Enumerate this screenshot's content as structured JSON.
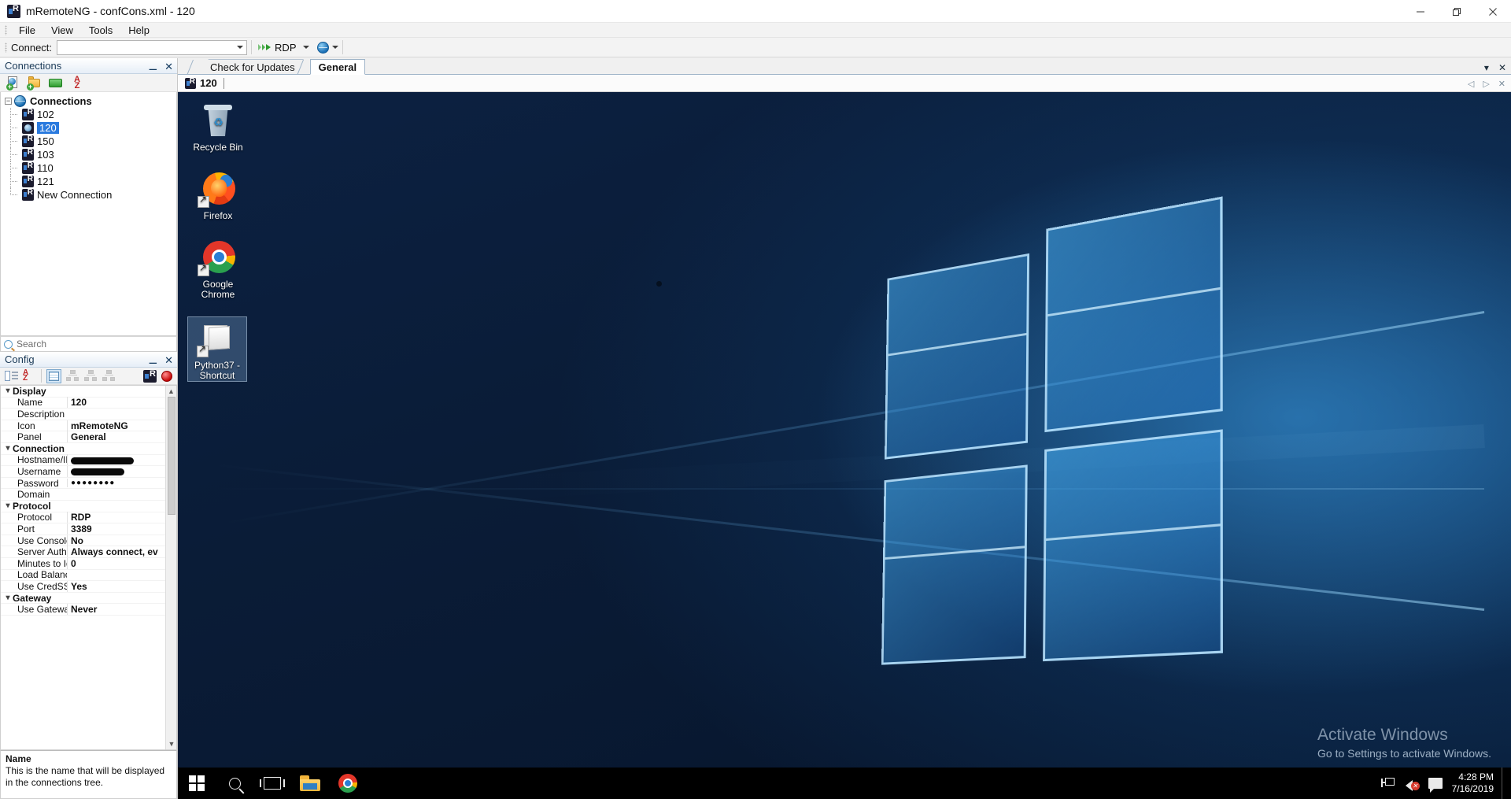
{
  "window": {
    "title": "mRemoteNG - confCons.xml - 120",
    "app_icon": "mremoteng-icon",
    "minimize": "—",
    "maximize": "❐",
    "close": "✕"
  },
  "menubar": {
    "items": [
      {
        "label": "File"
      },
      {
        "label": "View"
      },
      {
        "label": "Tools"
      },
      {
        "label": "Help"
      }
    ]
  },
  "toolbar": {
    "connect_label": "Connect:",
    "connect_value": "",
    "connect_placeholder": "",
    "protocol": "RDP"
  },
  "connections_panel": {
    "title": "Connections",
    "pin": "⚊",
    "close": "✕",
    "toolbar": [
      {
        "name": "new-connection-icon"
      },
      {
        "name": "new-folder-icon"
      },
      {
        "name": "new-session-icon"
      },
      {
        "name": "sort-az-icon",
        "label": "A",
        "sub": "Z"
      }
    ],
    "tree": {
      "root": "Connections",
      "nodes": [
        {
          "label": "102",
          "state": "idle"
        },
        {
          "label": "120",
          "state": "connected",
          "selected": true
        },
        {
          "label": "150",
          "state": "idle"
        },
        {
          "label": "103",
          "state": "idle"
        },
        {
          "label": "110",
          "state": "idle"
        },
        {
          "label": "121",
          "state": "idle"
        },
        {
          "label": "New Connection",
          "state": "idle"
        }
      ]
    },
    "search_placeholder": "Search"
  },
  "config_panel": {
    "title": "Config",
    "pin": "⚊",
    "close": "✕",
    "toolbar": [
      {
        "name": "categorized-icon"
      },
      {
        "name": "sort-alphabetical-icon"
      },
      {
        "name": "properties-icon"
      },
      {
        "name": "inheritance-icon"
      },
      {
        "name": "default-properties-icon"
      },
      {
        "name": "default-inheritance-icon"
      },
      {
        "name": "mremoteng-icon"
      },
      {
        "name": "record-icon"
      }
    ],
    "groups": [
      {
        "name": "Display",
        "rows": [
          {
            "name": "Name",
            "value": "120"
          },
          {
            "name": "Description",
            "value": ""
          },
          {
            "name": "Icon",
            "value": "mRemoteNG"
          },
          {
            "name": "Panel",
            "value": "General"
          }
        ]
      },
      {
        "name": "Connection",
        "rows": [
          {
            "name": "Hostname/IP",
            "value": "",
            "redacted": 80
          },
          {
            "name": "Username",
            "value": "",
            "redacted": 68
          },
          {
            "name": "Password",
            "value": "●●●●●●●●"
          },
          {
            "name": "Domain",
            "value": ""
          }
        ]
      },
      {
        "name": "Protocol",
        "rows": [
          {
            "name": "Protocol",
            "value": "RDP"
          },
          {
            "name": "Port",
            "value": "3389"
          },
          {
            "name": "Use Console Se",
            "value": "No"
          },
          {
            "name": "Server Authenti",
            "value": "Always connect, ev"
          },
          {
            "name": "Minutes to Idle",
            "value": "0"
          },
          {
            "name": "Load Balance Ir",
            "value": ""
          },
          {
            "name": "Use CredSSP",
            "value": "Yes"
          }
        ]
      },
      {
        "name": "Gateway",
        "rows": [
          {
            "name": "Use Gateway",
            "value": "Never"
          }
        ]
      }
    ],
    "help": {
      "title": "Name",
      "text": "This is the name that will be displayed in the connections tree."
    }
  },
  "document_tabs": {
    "tabs": [
      {
        "label": "Check for Updates",
        "active": false
      },
      {
        "label": "General",
        "active": true
      }
    ],
    "controls": {
      "dropdown": "▾",
      "close": "✕"
    }
  },
  "session_bar": {
    "label": "120",
    "icon": "rdp-session-icon",
    "controls": {
      "prev": "◁",
      "next": "▷",
      "close": "✕"
    }
  },
  "remote_desktop": {
    "desktop_icons": [
      {
        "label": "Recycle Bin",
        "icon": "recycle-bin-icon",
        "shortcut": false,
        "selected": false
      },
      {
        "label": "Firefox",
        "icon": "firefox-icon",
        "shortcut": true,
        "selected": false
      },
      {
        "label": "Google Chrome",
        "icon": "google-chrome-icon",
        "shortcut": true,
        "selected": false
      },
      {
        "label": "Python37 - Shortcut",
        "icon": "folder-shortcut-icon",
        "shortcut": true,
        "selected": true
      }
    ],
    "activation_watermark": {
      "title": "Activate Windows",
      "subtitle": "Go to Settings to activate Windows."
    },
    "taskbar": {
      "buttons": [
        {
          "name": "start-button",
          "icon": "windows-logo-icon"
        },
        {
          "name": "search-button",
          "icon": "search-icon"
        },
        {
          "name": "task-view-button",
          "icon": "task-view-icon"
        },
        {
          "name": "file-explorer-button",
          "icon": "file-explorer-icon"
        },
        {
          "name": "chrome-taskbar-button",
          "icon": "google-chrome-icon"
        }
      ],
      "tray": [
        {
          "name": "network-tray-icon",
          "icon": "network-icon"
        },
        {
          "name": "volume-tray-icon",
          "icon": "volume-muted-icon"
        },
        {
          "name": "action-center-tray-icon",
          "icon": "action-center-icon"
        }
      ],
      "clock": {
        "time": "4:28 PM",
        "date": "7/16/2019"
      }
    }
  },
  "colors": {
    "accent": "#2a7ade",
    "taskbar": "#000000",
    "panel_header": "#e6eef7"
  }
}
